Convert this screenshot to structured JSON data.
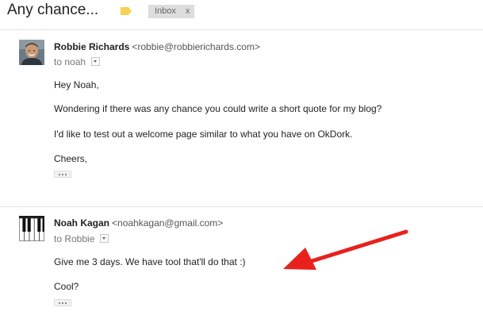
{
  "thread": {
    "subject": "Any chance...",
    "label": "Inbox",
    "label_remove": "x"
  },
  "colors": {
    "label_tag": "#f7d154",
    "annotation_arrow": "#e8211d"
  },
  "messages": [
    {
      "sender_name": "Robbie Richards",
      "sender_email": "<robbie@robbierichards.com>",
      "recipient": "to noah",
      "body": [
        "Hey Noah,",
        "Wondering if there was any chance you could write a short quote for my blog?",
        "I'd like to test out a welcome page similar to what you have on OkDork.",
        "Cheers,"
      ]
    },
    {
      "sender_name": "Noah Kagan",
      "sender_email": "<noahkagan@gmail.com>",
      "recipient": "to Robbie",
      "body": [
        "Give me 3 days. We have tool that'll do that :)",
        "Cool?"
      ]
    }
  ]
}
